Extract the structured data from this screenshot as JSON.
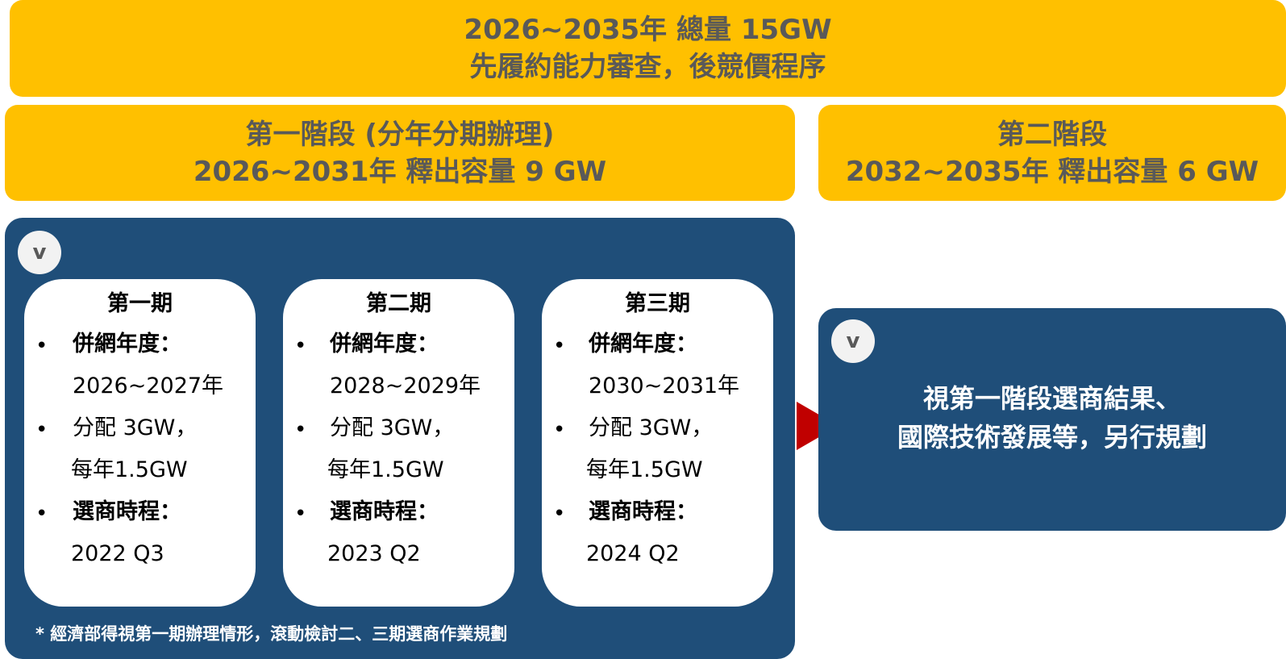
{
  "top_banner": {
    "line1": "2026~2035年 總量 15GW",
    "line2": "先履約能力審查，後競價程序"
  },
  "phase1_banner": {
    "line1": "第一階段 (分年分期辦理)",
    "line2": "2026~2031年 釋出容量 9 GW"
  },
  "phase2_banner": {
    "line1": "第二階段",
    "line2": "2032~2035年 釋出容量 6 GW"
  },
  "check_mark": "v",
  "bullet_char": "•",
  "periods": [
    {
      "title": "第一期",
      "grid_label": "併網年度：",
      "grid_years": "2026~2027年",
      "alloc_label": "分配 3GW，",
      "alloc_per_year": "每年1.5GW",
      "schedule_label": "選商時程：",
      "schedule_value": "2022 Q3"
    },
    {
      "title": "第二期",
      "grid_label": "併網年度：",
      "grid_years": "2028~2029年",
      "alloc_label": "分配 3GW，",
      "alloc_per_year": "每年1.5GW",
      "schedule_label": "選商時程：",
      "schedule_value": "2023 Q2"
    },
    {
      "title": "第三期",
      "grid_label": "併網年度：",
      "grid_years": "2030~2031年",
      "alloc_label": "分配 3GW，",
      "alloc_per_year": "每年1.5GW",
      "schedule_label": "選商時程：",
      "schedule_value": "2024 Q2"
    }
  ],
  "footnote": "* 經濟部得視第一期辦理情形，滾動檢討二、三期選商作業規劃",
  "phase2_panel": {
    "line1": "視第一階段選商結果、",
    "line2": "國際技術發展等，另行規劃"
  },
  "colors": {
    "banner_yellow": "#FFC000",
    "banner_text": "#595959",
    "panel_navy": "#1F4E79",
    "arrow_red": "#C00000"
  }
}
